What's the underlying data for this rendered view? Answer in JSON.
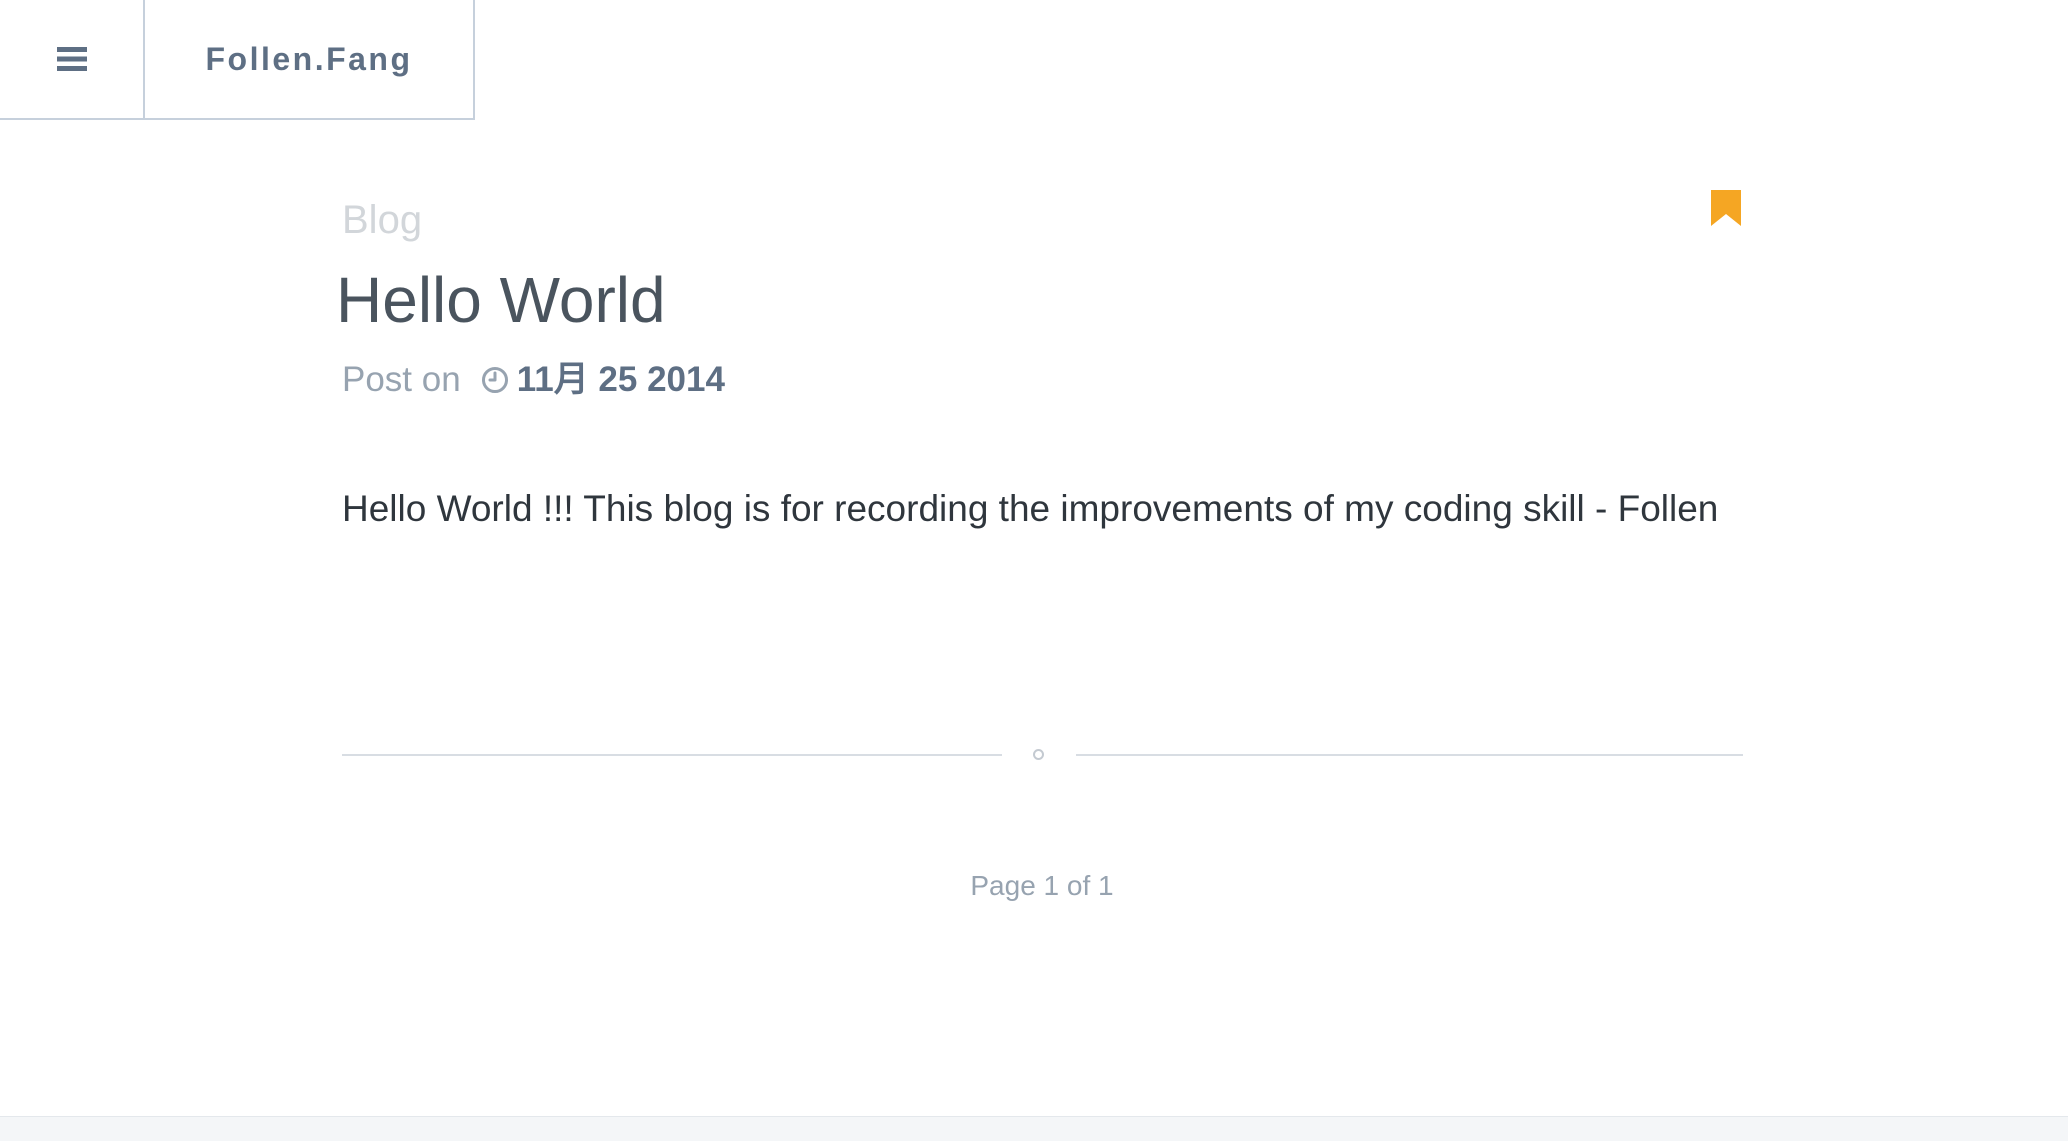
{
  "header": {
    "site_title": "Follen.Fang",
    "menu_icon": "hamburger-menu-icon"
  },
  "post": {
    "category": "Blog",
    "title": "Hello World",
    "meta_label": "Post on",
    "date_icon": "clock-icon",
    "date": "11月 25 2014",
    "bookmark_icon": "bookmark-icon",
    "content": "Hello World !!! This blog is for recording the improvements of my coding skill - Follen"
  },
  "pagination": {
    "text": "Page 1 of 1"
  },
  "colors": {
    "accent": "#f5a623",
    "text_dark": "#4a545e",
    "muted": "#97a3b0",
    "brand": "#5e6f84"
  }
}
